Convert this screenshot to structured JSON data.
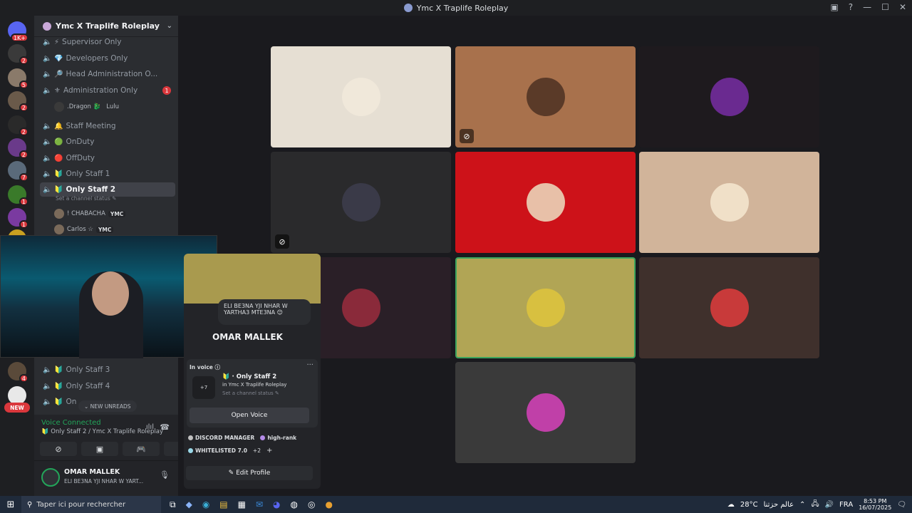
{
  "window": {
    "title": "Ymc X Traplife Roleplay"
  },
  "servers": [
    {
      "badge": "1K+",
      "color": "#5865f2"
    },
    {
      "badge": "2",
      "color": "#3a3a3a"
    },
    {
      "badge": "5",
      "color": "#8a7a6a"
    },
    {
      "badge": "2",
      "color": "#6a5a4a"
    },
    {
      "badge": "2",
      "color": "#2a2a2a"
    },
    {
      "badge": "2",
      "color": "#6a3a8a"
    },
    {
      "badge": "7",
      "color": "#5a6a7a"
    },
    {
      "badge": "1",
      "color": "#3a7a2a"
    },
    {
      "badge": "1",
      "color": "#7a3aa0"
    },
    {
      "badge": "",
      "color": "#c8a020"
    },
    {
      "badge": "4",
      "color": "#5a4a3a"
    },
    {
      "badge": "",
      "color": "#e8e8e8"
    }
  ],
  "server_new_badge": "NEW",
  "guild": {
    "name": "Ymc X Traplife Roleplay"
  },
  "channels": [
    {
      "emoji": "⚡",
      "name": "Supervisor Only"
    },
    {
      "emoji": "💎",
      "name": "Developers Only"
    },
    {
      "emoji": "🔎",
      "name": "Head Administration O..."
    },
    {
      "emoji": "⚜",
      "name": "Administration Only",
      "mention": "1"
    },
    {
      "emoji": "🔔",
      "name": "Staff Meeting"
    },
    {
      "emoji": "🟢",
      "name": "OnDuty"
    },
    {
      "emoji": "🔴",
      "name": "OffDuty"
    },
    {
      "emoji": "🔰",
      "name": "Only Staff 1"
    },
    {
      "emoji": "🔰",
      "name": "Only Staff 2",
      "active": true
    },
    {
      "emoji": "🔰",
      "name": "Only Staff 3"
    },
    {
      "emoji": "🔰",
      "name": "Only Staff 4"
    },
    {
      "emoji": "🔰",
      "name": "On"
    }
  ],
  "admin_users": {
    "u1": ".Dragon 🐉",
    "u2": "Lulu"
  },
  "active_channel": {
    "status": "Set a channel status ✎",
    "users": [
      {
        "name": "! CHABACHA",
        "tag": "YMC"
      },
      {
        "name": "Carlos ☆",
        "tag": "YMC"
      }
    ]
  },
  "new_unreads": "NEW UNREADS",
  "voice": {
    "connected": "Voice Connected",
    "location": "Only Staff 2 / Ymc X Traplife Roleplay"
  },
  "user": {
    "name": "OMAR MALLEK",
    "status": "ELI BE3NA YJI NHAR W YART..."
  },
  "profile": {
    "bio": "ELI BE3NA YJI NHAR W YARTHA3 MTE3NA 😊",
    "name": "OMAR MALLEK",
    "in_voice": "In voice",
    "voice_channel": "Only Staff 2",
    "voice_server": "in Ymc X Traplife Roleplay",
    "voice_status": "Set a channel status ✎",
    "voice_count": "+7",
    "open_voice": "Open Voice",
    "roles": [
      {
        "name": "DISCORD MANAGER",
        "color": "#c0c0c0"
      },
      {
        "name": "high-rank",
        "color": "#b48be8"
      },
      {
        "name": "WHITELISTED 7.0",
        "color": "#9ad8e8"
      }
    ],
    "roles_more": "+2",
    "edit_profile": "Edit Profile"
  },
  "tiles": [
    {
      "bg": "#e6dfd3",
      "border": "none",
      "muted": false
    },
    {
      "bg": "#a8714c",
      "border": "none",
      "muted": true
    },
    {
      "bg": "#1e1a1e",
      "border": "none",
      "muted": false
    },
    {
      "bg": "#2a2a2c",
      "border": "none",
      "muted": true
    },
    {
      "bg": "#cd1219",
      "border": "none",
      "muted": false
    },
    {
      "bg": "#d1b49a",
      "border": "none",
      "muted": false
    },
    {
      "bg": "#2a1f27",
      "border": "none",
      "muted": false
    },
    {
      "bg": "#b1a555",
      "border": "#3ba55d",
      "muted": false
    },
    {
      "bg": "#3f302c",
      "border": "none",
      "muted": false
    },
    {
      "bg": "#3a3a3a",
      "border": "none",
      "muted": false
    }
  ],
  "taskbar": {
    "search": "Taper ici pour rechercher",
    "weather": "28°C",
    "weather_text": "عالم حزتنا",
    "lang": "FRA",
    "time": "8:53 PM",
    "date": "16/07/2025"
  }
}
